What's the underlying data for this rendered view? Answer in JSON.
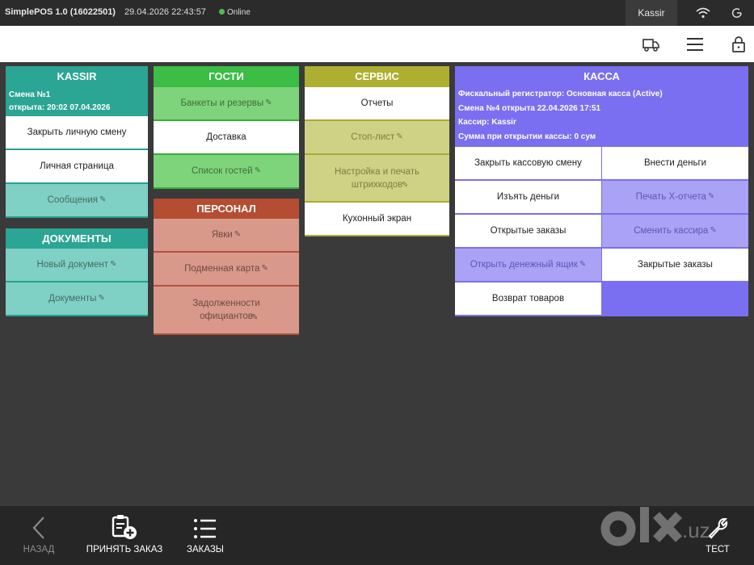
{
  "topbar": {
    "app_title": "SimplePOS 1.0 (16022501)",
    "datetime": "29.04.2026 22:43:57",
    "status": "Online",
    "user": "Kassir",
    "icons": [
      "wifi-icon",
      "power-icon"
    ]
  },
  "toolbar": {
    "icons": [
      "delivery-truck-icon",
      "menu-icon",
      "lock-icon"
    ]
  },
  "kassir": {
    "title": "KASSIR",
    "shift": "Смена №1",
    "opened": "открыта: 20:02 07.04.2026",
    "buttons": [
      "Закрыть личную смену",
      "Личная страница",
      "Сообщения"
    ]
  },
  "docs": {
    "title": "ДОКУМЕНТЫ",
    "buttons": [
      "Новый документ",
      "Документы"
    ]
  },
  "guests": {
    "title": "ГОСТИ",
    "buttons": [
      "Банкеты и резервы",
      "Доставка",
      "Список гостей"
    ]
  },
  "staff": {
    "title": "ПЕРСОНАЛ",
    "buttons": [
      "Явки",
      "Подменная карта",
      "Задолженности официантов"
    ]
  },
  "service": {
    "title": "СЕРВИС",
    "buttons": [
      "Отчеты",
      "Стоп-лист",
      "Настройка и печать штрихкодов",
      "Кухонный экран"
    ]
  },
  "kassa": {
    "title": "КАССА",
    "info": [
      "Фискальный регистратор: Основная касса (Active)",
      "Смена №4 открыта 22.04.2026 17:51",
      "Кассир: Kassir",
      "Сумма при открытии кассы: 0 сум"
    ],
    "buttons": [
      "Закрыть кассовую смену",
      "Внести деньги",
      "Изъять деньги",
      "Печать Х-отчета",
      "Открытые заказы",
      "Сменить кассира",
      "Открыть денежный ящик",
      "Закрытые заказы",
      "Возврат товаров"
    ]
  },
  "bottombar": {
    "back": "НАЗАД",
    "take_order": "ПРИНЯТЬ ЗАКАЗ",
    "orders": "ЗАКАЗЫ",
    "test": "ТЕСТ"
  },
  "watermark": {
    "text": "olx.uz"
  },
  "colors": {
    "kassir": "#2ba594",
    "guests": "#3cbd46",
    "staff": "#b44d32",
    "service": "#aeaf30",
    "kassa": "#7a6ff0"
  }
}
